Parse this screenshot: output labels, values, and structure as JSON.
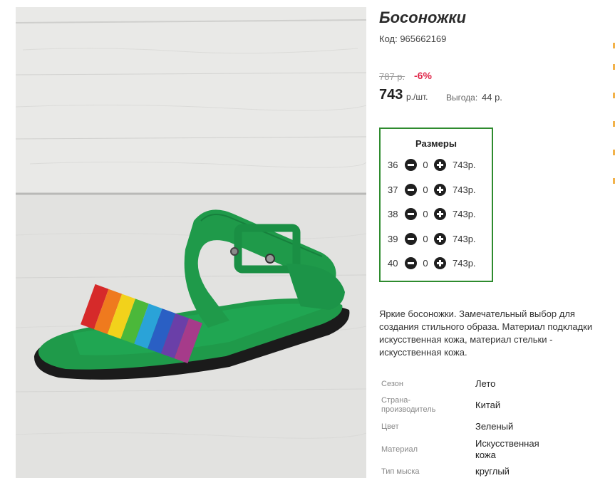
{
  "product": {
    "title": "Босоножки",
    "code": "Код: 965662169"
  },
  "pricing": {
    "old_price": "787 р.",
    "discount": "-6%",
    "price": "743",
    "unit": "р./шт.",
    "savings_label": "Выгода:",
    "savings_value": "44 р."
  },
  "sizes": {
    "title": "Размеры",
    "rows": [
      {
        "size": "36",
        "qty": "0",
        "price": "743р."
      },
      {
        "size": "37",
        "qty": "0",
        "price": "743р."
      },
      {
        "size": "38",
        "qty": "0",
        "price": "743р."
      },
      {
        "size": "39",
        "qty": "0",
        "price": "743р."
      },
      {
        "size": "40",
        "qty": "0",
        "price": "743р."
      }
    ]
  },
  "description": "Яркие босоножки. Замечательный выбор для создания стильного образа. Материал подкладки искусственная кожа, материал стельки - искусственная кожа.",
  "specs": [
    {
      "label": "Сезон",
      "value": "Лето"
    },
    {
      "label": "Страна-производитель",
      "value": "Китай"
    },
    {
      "label": "Цвет",
      "value": "Зеленый"
    },
    {
      "label": "Материал",
      "value": "Искусственная кожа"
    },
    {
      "label": "Тип мыска",
      "value": "круглый"
    }
  ],
  "colors": {
    "accent_green": "#2e8b2e",
    "discount_red": "#e0284a",
    "sandal_green": "#1e9a4c"
  }
}
